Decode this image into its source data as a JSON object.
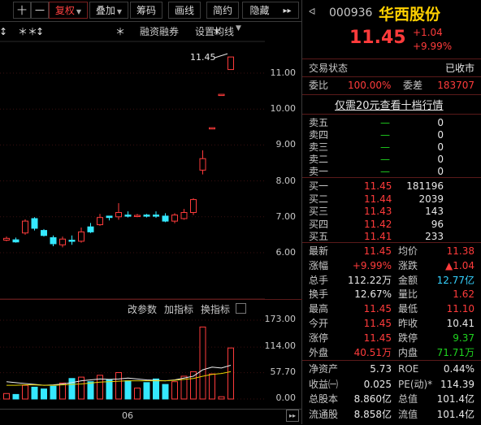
{
  "toolbar": {
    "items": [
      {
        "label": "十",
        "active": false
      },
      {
        "label": "一",
        "active": false
      },
      {
        "label": "复权",
        "active": true,
        "caret": true
      },
      {
        "label": "叠加",
        "active": false,
        "caret": true
      },
      {
        "label": "筹码",
        "active": false
      },
      {
        "label": "画线",
        "active": false
      },
      {
        "label": "简约",
        "active": false
      },
      {
        "label": "隐藏",
        "active": false
      },
      {
        "label": "▸▸",
        "active": false
      }
    ]
  },
  "chart": {
    "links": {
      "margin": "融资融券",
      "ma": "设置均线"
    },
    "marker_row": [
      "↕",
      "＊",
      "＊",
      "↕",
      "＊",
      "＊"
    ],
    "last_price_callout": "11.45",
    "price_ticks": [
      "11.00",
      "10.00",
      "9.00",
      "8.00",
      "7.00",
      "6.00"
    ],
    "vol_menu": {
      "params": "改参数",
      "add": "加指标",
      "switch": "换指标"
    },
    "vol_ticks": [
      "173.00",
      "114.00",
      "57.70",
      "0.00"
    ],
    "date_label": "06",
    "candles": [
      {
        "o": 6.35,
        "c": 6.4,
        "h": 6.45,
        "l": 6.32,
        "up": true
      },
      {
        "o": 6.3,
        "c": 6.36,
        "h": 6.42,
        "l": 6.28,
        "up": false
      },
      {
        "o": 6.55,
        "c": 6.88,
        "h": 6.93,
        "l": 6.5,
        "up": true
      },
      {
        "o": 6.95,
        "c": 6.68,
        "h": 6.99,
        "l": 6.62,
        "up": false
      },
      {
        "o": 6.62,
        "c": 6.48,
        "h": 6.66,
        "l": 6.45,
        "up": false
      },
      {
        "o": 6.42,
        "c": 6.25,
        "h": 6.48,
        "l": 6.18,
        "up": false
      },
      {
        "o": 6.22,
        "c": 6.38,
        "h": 6.45,
        "l": 6.15,
        "up": true
      },
      {
        "o": 6.35,
        "c": 6.32,
        "h": 6.48,
        "l": 6.22,
        "up": false
      },
      {
        "o": 6.32,
        "c": 6.58,
        "h": 6.7,
        "l": 6.28,
        "up": true
      },
      {
        "o": 6.72,
        "c": 6.58,
        "h": 6.83,
        "l": 6.55,
        "up": false
      },
      {
        "o": 6.78,
        "c": 6.98,
        "h": 7.08,
        "l": 6.75,
        "up": true
      },
      {
        "o": 7.02,
        "c": 6.98,
        "h": 7.03,
        "l": 6.9,
        "up": false
      },
      {
        "o": 7.0,
        "c": 7.12,
        "h": 7.38,
        "l": 6.92,
        "up": true
      },
      {
        "o": 7.05,
        "c": 7.02,
        "h": 7.15,
        "l": 6.98,
        "up": false
      },
      {
        "o": 7.03,
        "c": 7.04,
        "h": 7.08,
        "l": 6.99,
        "up": true
      },
      {
        "o": 7.05,
        "c": 7.03,
        "h": 7.08,
        "l": 6.98,
        "up": false
      },
      {
        "o": 7.05,
        "c": 7.02,
        "h": 7.15,
        "l": 6.97,
        "up": false
      },
      {
        "o": 7.02,
        "c": 6.88,
        "h": 7.1,
        "l": 6.85,
        "up": false
      },
      {
        "o": 6.88,
        "c": 7.05,
        "h": 7.1,
        "l": 6.82,
        "up": true
      },
      {
        "o": 6.95,
        "c": 7.12,
        "h": 7.22,
        "l": 6.92,
        "up": true
      },
      {
        "o": 7.12,
        "c": 7.48,
        "h": 7.52,
        "l": 7.05,
        "up": true
      },
      {
        "o": 8.3,
        "c": 8.62,
        "h": 8.85,
        "l": 8.18,
        "up": true
      },
      {
        "o": 9.45,
        "c": 9.48,
        "h": 9.48,
        "l": 9.45,
        "up": true
      },
      {
        "o": 10.41,
        "c": 10.41,
        "h": 10.41,
        "l": 10.41,
        "up": true
      },
      {
        "o": 11.1,
        "c": 11.45,
        "h": 11.45,
        "l": 11.1,
        "up": true
      }
    ],
    "volume": [
      {
        "v": 12,
        "up": true
      },
      {
        "v": 10,
        "up": false
      },
      {
        "v": 30,
        "up": true
      },
      {
        "v": 26,
        "up": false
      },
      {
        "v": 22,
        "up": false
      },
      {
        "v": 28,
        "up": false
      },
      {
        "v": 35,
        "up": true
      },
      {
        "v": 45,
        "up": false
      },
      {
        "v": 48,
        "up": true
      },
      {
        "v": 38,
        "up": false
      },
      {
        "v": 52,
        "up": true
      },
      {
        "v": 42,
        "up": false
      },
      {
        "v": 58,
        "up": true
      },
      {
        "v": 40,
        "up": false
      },
      {
        "v": 24,
        "up": true
      },
      {
        "v": 36,
        "up": false
      },
      {
        "v": 44,
        "up": false
      },
      {
        "v": 32,
        "up": false
      },
      {
        "v": 38,
        "up": true
      },
      {
        "v": 50,
        "up": true
      },
      {
        "v": 60,
        "up": true
      },
      {
        "v": 158,
        "up": true
      },
      {
        "v": 55,
        "up": true
      },
      {
        "v": 5,
        "up": true
      },
      {
        "v": 112,
        "up": true
      }
    ],
    "ma_a": [
      38,
      36,
      34,
      32,
      30,
      31,
      33,
      36,
      40,
      42,
      44,
      43,
      44,
      46,
      44,
      42,
      41,
      40,
      42,
      46,
      50,
      64,
      70,
      68,
      74
    ],
    "ma_b": [
      30,
      30,
      31,
      31,
      30,
      30,
      31,
      32,
      33,
      35,
      37,
      38,
      39,
      40,
      40,
      40,
      40,
      40,
      41,
      43,
      45,
      50,
      54,
      56,
      60
    ]
  },
  "quote": {
    "code": "000936",
    "name": "华西股份",
    "price": "11.45",
    "change": "+1.04",
    "change_pct": "+9.99%"
  },
  "status": {
    "label": "交易状态",
    "value": "已收市"
  },
  "order_ratio": {
    "label": "委比",
    "value": "100.00%",
    "diff_label": "委差",
    "diff_value": "183707"
  },
  "promo": "仅需20元查看十档行情",
  "asks": [
    {
      "label": "卖五",
      "price": "—",
      "vol": "0"
    },
    {
      "label": "卖四",
      "price": "—",
      "vol": "0"
    },
    {
      "label": "卖三",
      "price": "—",
      "vol": "0"
    },
    {
      "label": "卖二",
      "price": "—",
      "vol": "0"
    },
    {
      "label": "卖一",
      "price": "—",
      "vol": "0"
    }
  ],
  "bids": [
    {
      "label": "买一",
      "price": "11.45",
      "vol": "181196"
    },
    {
      "label": "买二",
      "price": "11.44",
      "vol": "2039"
    },
    {
      "label": "买三",
      "price": "11.43",
      "vol": "143"
    },
    {
      "label": "买四",
      "price": "11.42",
      "vol": "96"
    },
    {
      "label": "买五",
      "price": "11.41",
      "vol": "233"
    }
  ],
  "stats": [
    {
      "l1": "最新",
      "v1": "11.45",
      "c1": "red",
      "l2": "均价",
      "v2": "11.38",
      "c2": "red"
    },
    {
      "l1": "涨幅",
      "v1": "+9.99%",
      "c1": "red",
      "l2": "涨跌",
      "v2": "▲1.04",
      "c2": "red"
    },
    {
      "l1": "总手",
      "v1": "112.22万",
      "c1": "wht",
      "l2": "金额",
      "v2": "12.77亿",
      "c2": "cyan"
    },
    {
      "l1": "换手",
      "v1": "12.67%",
      "c1": "wht",
      "l2": "量比",
      "v2": "1.62",
      "c2": "red"
    },
    {
      "l1": "最高",
      "v1": "11.45",
      "c1": "red",
      "l2": "最低",
      "v2": "11.10",
      "c2": "red"
    },
    {
      "l1": "今开",
      "v1": "11.45",
      "c1": "red",
      "l2": "昨收",
      "v2": "10.41",
      "c2": "wht"
    },
    {
      "l1": "涨停",
      "v1": "11.45",
      "c1": "red",
      "l2": "跌停",
      "v2": "9.37",
      "c2": "grn"
    },
    {
      "l1": "外盘",
      "v1": "40.51万",
      "c1": "red",
      "l2": "内盘",
      "v2": "71.71万",
      "c2": "grn"
    }
  ],
  "fundamentals": [
    {
      "l1": "净资产",
      "v1": "5.73",
      "l2": "ROE",
      "v2": "0.44%"
    },
    {
      "l1": "收益㈠",
      "v1": "0.025",
      "l2": "PE(动)*",
      "v2": "114.39"
    },
    {
      "l1": "总股本",
      "v1": "8.860亿",
      "l2": "总值",
      "v2": "101.4亿"
    },
    {
      "l1": "流通股",
      "v1": "8.858亿",
      "l2": "流值",
      "v2": "101.4亿"
    }
  ],
  "colors": {
    "up": "#ff3b3b",
    "down": "#35e8ff",
    "ma_a": "#f0f0f0",
    "ma_b": "#e6d200"
  }
}
